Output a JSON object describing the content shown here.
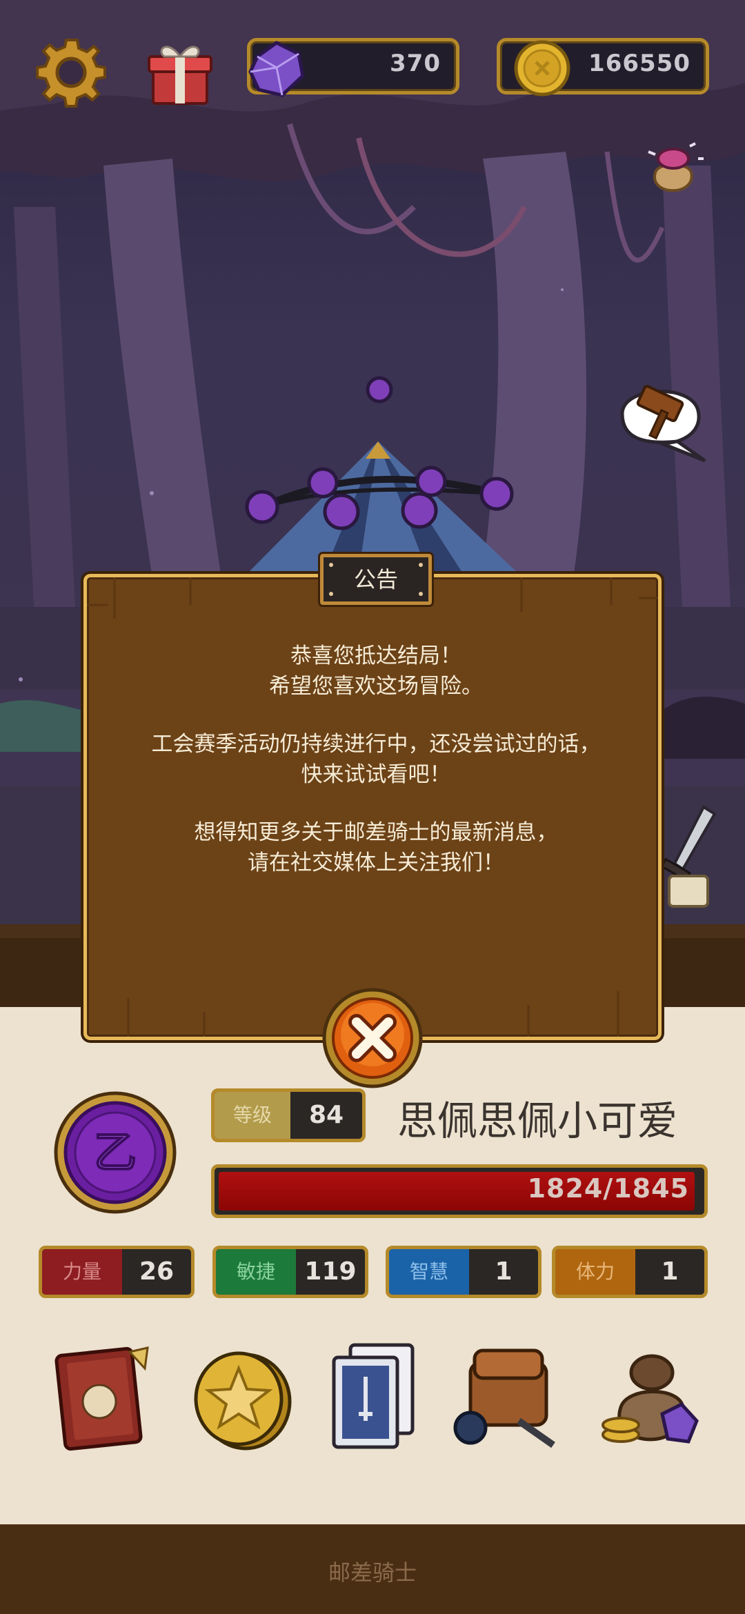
{
  "hud": {
    "gems": "370",
    "coins": "166550"
  },
  "modal": {
    "title": "公告",
    "paragraphs": [
      "恭喜您抵达结局！\n希望您喜欢这场冒险。",
      "工会赛季活动仍持续进行中，还没尝试过的话，\n快来试试看吧！",
      "想得知更多关于邮差骑士的最新消息，\n请在社交媒体上关注我们！"
    ]
  },
  "player": {
    "level_label": "等级",
    "level": "84",
    "name": "思佩思佩小可爱",
    "hp_text": "1824/1845",
    "hp_fraction": 0.9886,
    "rank_glyph": "乙"
  },
  "stats": [
    {
      "label": "力量",
      "value": "26",
      "color": "#8e1d22",
      "text_color": "#d98a8a"
    },
    {
      "label": "敏捷",
      "value": "119",
      "color": "#1c7a3a",
      "text_color": "#8ad3a0"
    },
    {
      "label": "智慧",
      "value": "1",
      "color": "#1b63a8",
      "text_color": "#8fc0ea"
    },
    {
      "label": "体力",
      "value": "1",
      "color": "#b0660f",
      "text_color": "#e9b77a"
    }
  ],
  "menu": [
    "journal-book-icon",
    "star-coin-icon",
    "cards-icon",
    "backpack-icon",
    "treasure-bag-icon"
  ],
  "footer": {
    "label": "邮差骑士"
  },
  "colors": {
    "gold_border": "#b58a2a",
    "modal_wood": "#6c4217",
    "modal_text": "#f6ecd6",
    "hp_red": "#b01010"
  }
}
